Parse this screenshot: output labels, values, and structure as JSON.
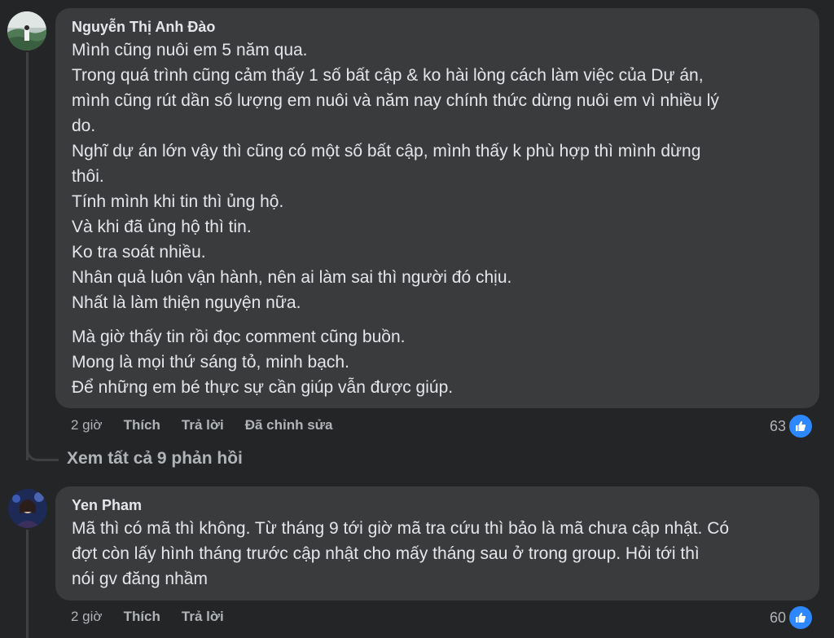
{
  "comments": [
    {
      "author": "Nguyễn Thị Anh Đào",
      "lines": [
        "Mình cũng nuôi em 5 năm qua.",
        "Trong quá trình cũng cảm thấy 1 số bất cập & ko hài lòng cách làm việc của Dự án,",
        "mình cũng rút dần số lượng em nuôi và năm nay chính thức dừng nuôi em vì nhiều lý",
        "do.",
        "Nghĩ dự án lớn vậy thì cũng có một số bất cập, mình thấy k phù hợp thì mình dừng",
        "thôi.",
        "Tính mình khi tin thì ủng hộ.",
        "Và khi đã ủng hộ thì tin.",
        "Ko tra soát nhiều.",
        "Nhân quả luôn vận hành, nên ai làm sai thì người đó chịu.",
        "Nhất là làm thiện nguyện nữa."
      ],
      "lines2": [
        "Mà giờ thấy tin rồi đọc comment cũng buồn.",
        "Mong là mọi thứ sáng tỏ, minh bạch.",
        "Để những em bé thực sự cần giúp vẫn được giúp."
      ],
      "time": "2 giờ",
      "like_label": "Thích",
      "reply_label": "Trả lời",
      "edited_label": "Đã chỉnh sửa",
      "reaction_count": "63",
      "reaction_icon": "like-icon"
    },
    {
      "author": "Yen Pham",
      "lines": [
        "Mã thì có mã thì không. Từ tháng 9 tới giờ mã tra cứu thì bảo là mã chưa cập nhật. Có",
        "đợt còn lấy hình tháng trước cập nhật cho mấy tháng sau ở trong group. Hỏi tới thì",
        "nói gv đăng nhầm"
      ],
      "time": "2 giờ",
      "like_label": "Thích",
      "reply_label": "Trả lời",
      "reaction_count": "60",
      "reaction_icon": "like-icon"
    }
  ],
  "view_all_replies": "Xem tất cả 9 phản hồi",
  "colors": {
    "background": "#242526",
    "bubble": "#3a3b3c",
    "text": "#e4e6eb",
    "secondary_text": "#b0b3b8",
    "like_blue": "#2d88ff"
  }
}
